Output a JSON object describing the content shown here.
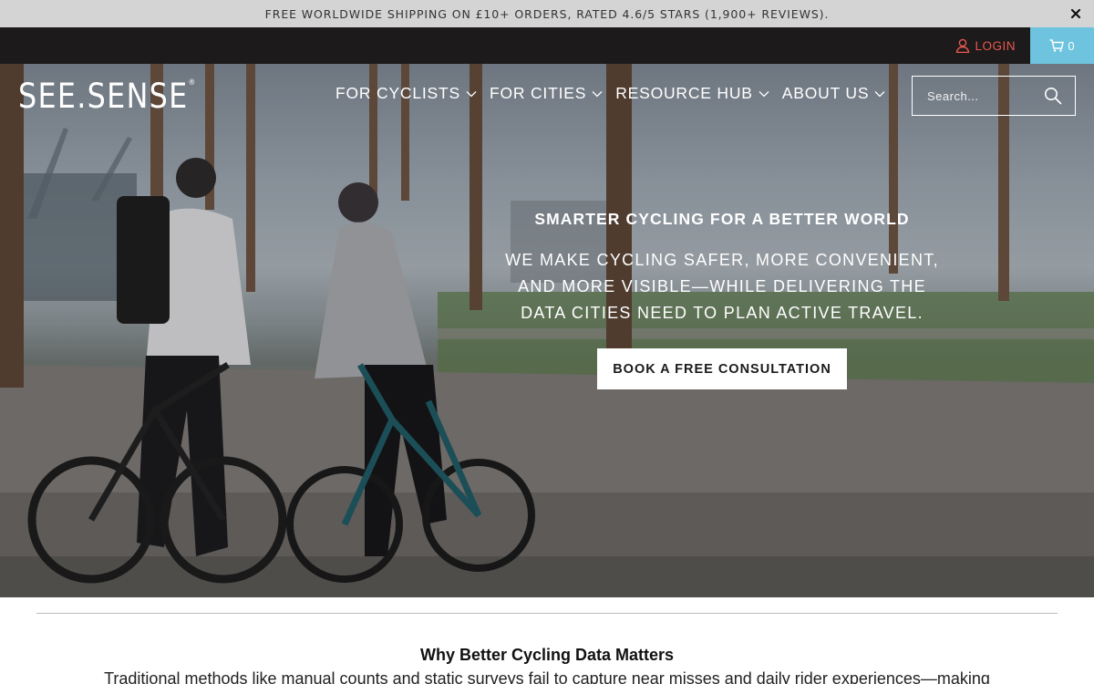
{
  "announcement": {
    "text": "FREE WORLDWIDE SHIPPING ON £10+ ORDERS, RATED 4.6/5 STARS (1,900+ REVIEWS).",
    "close_icon": "close-icon"
  },
  "utility": {
    "login_label": "LOGIN",
    "login_icon": "user-icon",
    "cart_count": "0",
    "cart_icon": "cart-icon"
  },
  "header": {
    "logo_text": "SEE.SENSE",
    "logo_mark": "®",
    "nav": [
      {
        "label": "FOR CYCLISTS"
      },
      {
        "label": "FOR CITIES"
      },
      {
        "label": "RESOURCE HUB"
      },
      {
        "label": "ABOUT US"
      }
    ],
    "search_placeholder": "Search..."
  },
  "hero": {
    "heading": "SMARTER CYCLING FOR A BETTER WORLD",
    "subheading": "WE MAKE CYCLING SAFER, MORE CONVENIENT, AND MORE VISIBLE—WHILE DELIVERING THE DATA CITIES NEED TO PLAN ACTIVE TRAVEL.",
    "cta_label": "BOOK A FREE CONSULTATION"
  },
  "section": {
    "title": "Why Better Cycling Data Matters",
    "body": "Traditional methods like manual counts and static surveys fail to capture near misses and daily rider experiences—making"
  },
  "colors": {
    "announcement_bg": "#d4d4d4",
    "utility_bg": "#1c1a1b",
    "login_accent": "#e9584e",
    "cart_bg": "#6ec3df"
  }
}
